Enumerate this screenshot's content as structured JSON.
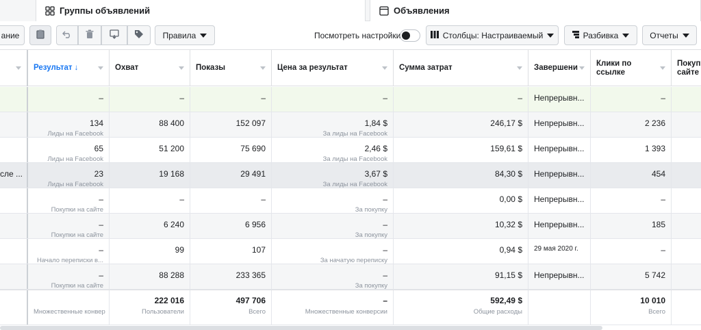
{
  "tabs": {
    "adsets_label": "Группы объявлений",
    "ads_label": "Объявления"
  },
  "toolbar": {
    "partial_left_label": "ание",
    "rules_label": "Правила",
    "view_settings_label": "Посмотреть настройки",
    "columns_label": "Столбцы: Настраиваемый",
    "breakdown_label": "Разбивка",
    "reports_label": "Отчеты"
  },
  "columns": [
    {
      "key": "result",
      "label": "Результат ↓"
    },
    {
      "key": "reach",
      "label": "Охват"
    },
    {
      "key": "impressions",
      "label": "Показы"
    },
    {
      "key": "cpr",
      "label": "Цена за результат"
    },
    {
      "key": "spent",
      "label": "Сумма затрат"
    },
    {
      "key": "ends",
      "label": "Завершени"
    },
    {
      "key": "clicks",
      "label": "Клики по ссылке"
    },
    {
      "key": "purchases",
      "label": "Покуп сайте"
    }
  ],
  "rows": [
    {
      "first": "",
      "result": "–",
      "result_sub": "",
      "reach": "–",
      "impressions": "–",
      "cpr": "–",
      "cpr_sub": "",
      "spent": "–",
      "ends": "Непрерывн...",
      "clicks": "–"
    },
    {
      "first": "",
      "result": "134",
      "result_sub": "Лиды на Facebook",
      "reach": "88 400",
      "impressions": "152 097",
      "cpr": "1,84 $",
      "cpr_sub": "За лиды на Facebook",
      "spent": "246,17 $",
      "ends": "Непрерывн...",
      "clicks": "2 236"
    },
    {
      "first": "",
      "result": "65",
      "result_sub": "Лиды на Facebook",
      "reach": "51 200",
      "impressions": "75 690",
      "cpr": "2,46 $",
      "cpr_sub": "За лиды на Facebook",
      "spent": "159,61 $",
      "ends": "Непрерывн...",
      "clicks": "1 393"
    },
    {
      "first": "сле ...",
      "result": "23",
      "result_sub": "Лиды на Facebook",
      "reach": "19 168",
      "impressions": "29 491",
      "cpr": "3,67 $",
      "cpr_sub": "За лиды на Facebook",
      "spent": "84,30 $",
      "ends": "Непрерывн...",
      "clicks": "454"
    },
    {
      "first": "",
      "result": "–",
      "result_sub": "Покупки на сайте",
      "reach": "–",
      "impressions": "–",
      "cpr": "–",
      "cpr_sub": "За покупку",
      "spent": "0,00 $",
      "ends": "Непрерывн...",
      "clicks": "–"
    },
    {
      "first": "",
      "result": "–",
      "result_sub": "Покупки на сайте",
      "reach": "6 240",
      "impressions": "6 956",
      "cpr": "–",
      "cpr_sub": "За покупку",
      "spent": "10,32 $",
      "ends": "Непрерывн...",
      "clicks": "185"
    },
    {
      "first": "",
      "result": "–",
      "result_sub": "Начало переписки в...",
      "reach": "99",
      "impressions": "107",
      "cpr": "–",
      "cpr_sub": "За начатую переписку",
      "spent": "0,94 $",
      "ends": "29 мая 2020 г.",
      "clicks": "–"
    },
    {
      "first": "",
      "result": "–",
      "result_sub": "Покупки на сайте",
      "reach": "88 288",
      "impressions": "233 365",
      "cpr": "–",
      "cpr_sub": "За покупку",
      "spent": "91,15 $",
      "ends": "Непрерывн...",
      "clicks": "5 742"
    }
  ],
  "totals": {
    "result": "",
    "result_sub": "Множественные конвер",
    "reach": "222 016",
    "reach_sub": "Пользователи",
    "impressions": "497 706",
    "impressions_sub": "Всего",
    "cpr": "–",
    "cpr_sub": "Множественные конверсии",
    "spent": "592,49 $",
    "spent_sub": "Общие расходы",
    "clicks": "10 010",
    "clicks_sub": "Всего"
  }
}
